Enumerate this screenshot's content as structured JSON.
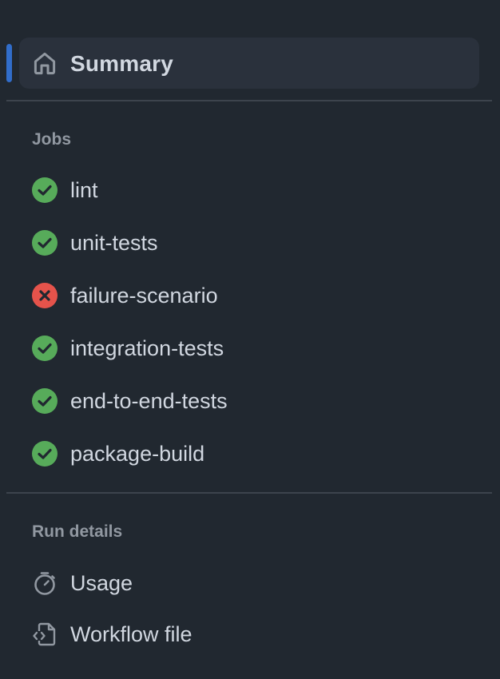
{
  "summary": {
    "label": "Summary",
    "icon": "home-icon"
  },
  "jobs_section": {
    "heading": "Jobs",
    "items": [
      {
        "label": "lint",
        "status": "success"
      },
      {
        "label": "unit-tests",
        "status": "success"
      },
      {
        "label": "failure-scenario",
        "status": "failure"
      },
      {
        "label": "integration-tests",
        "status": "success"
      },
      {
        "label": "end-to-end-tests",
        "status": "success"
      },
      {
        "label": "package-build",
        "status": "success"
      }
    ]
  },
  "run_details": {
    "heading": "Run details",
    "items": [
      {
        "label": "Usage",
        "icon": "stopwatch-icon"
      },
      {
        "label": "Workflow file",
        "icon": "file-code-icon"
      }
    ]
  },
  "colors": {
    "background": "#212830",
    "active_row": "#2a313c",
    "accent": "#316dca",
    "success": "#57ab5a",
    "failure": "#e5534b",
    "text": "#d1d7e0",
    "muted": "#9198a1"
  }
}
